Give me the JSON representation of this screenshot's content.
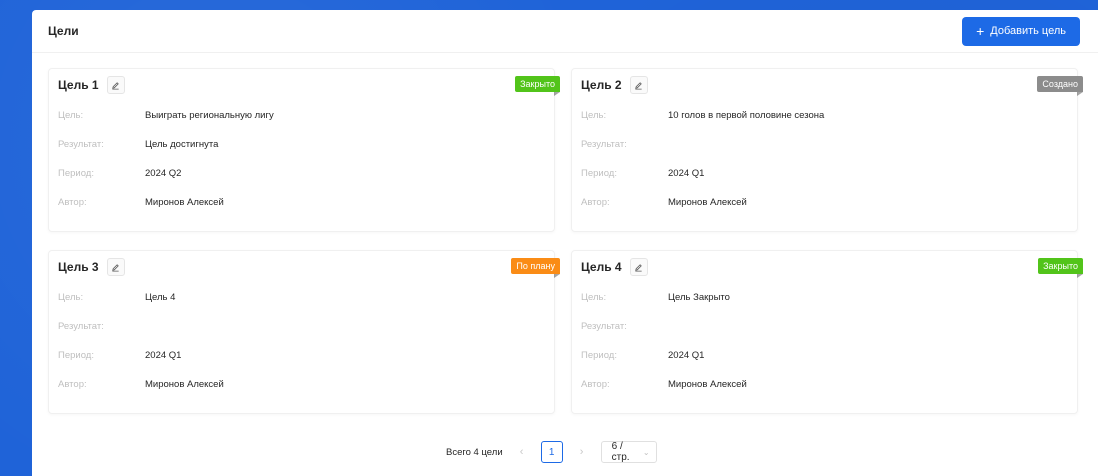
{
  "header": {
    "title": "Цели",
    "add_button": "Добавить цель"
  },
  "labels": {
    "goal": "Цель:",
    "result": "Результат:",
    "period": "Период:",
    "author": "Автор:"
  },
  "cards": [
    {
      "title": "Цель 1",
      "status": "Закрыто",
      "status_color": "#52c41a",
      "goal": "Выиграть региональную лигу",
      "result": "Цель достигнута",
      "period": "2024 Q2",
      "author": "Миронов Алексей"
    },
    {
      "title": "Цель 2",
      "status": "Создано",
      "status_color": "#8c8c8c",
      "goal": "10 голов в первой половине сезона",
      "result": "",
      "period": "2024 Q1",
      "author": "Миронов Алексей"
    },
    {
      "title": "Цель 3",
      "status": "По плану",
      "status_color": "#fa8c16",
      "goal": "Цель 4",
      "result": "",
      "period": "2024 Q1",
      "author": "Миронов Алексей"
    },
    {
      "title": "Цель 4",
      "status": "Закрыто",
      "status_color": "#52c41a",
      "goal": "Цель Закрыто",
      "result": "",
      "period": "2024 Q1",
      "author": "Миронов Алексей"
    }
  ],
  "pagination": {
    "total": "Всего 4 цели",
    "current_page": "1",
    "page_size": "6 / стр."
  },
  "icons": {
    "add": "plus-icon",
    "edit": "pencil-icon",
    "prev": "chevron-left-icon",
    "next": "chevron-right-icon",
    "dropdown": "chevron-down-icon"
  },
  "colors": {
    "primary": "#1d6ae6",
    "background": "#1f63d8"
  }
}
